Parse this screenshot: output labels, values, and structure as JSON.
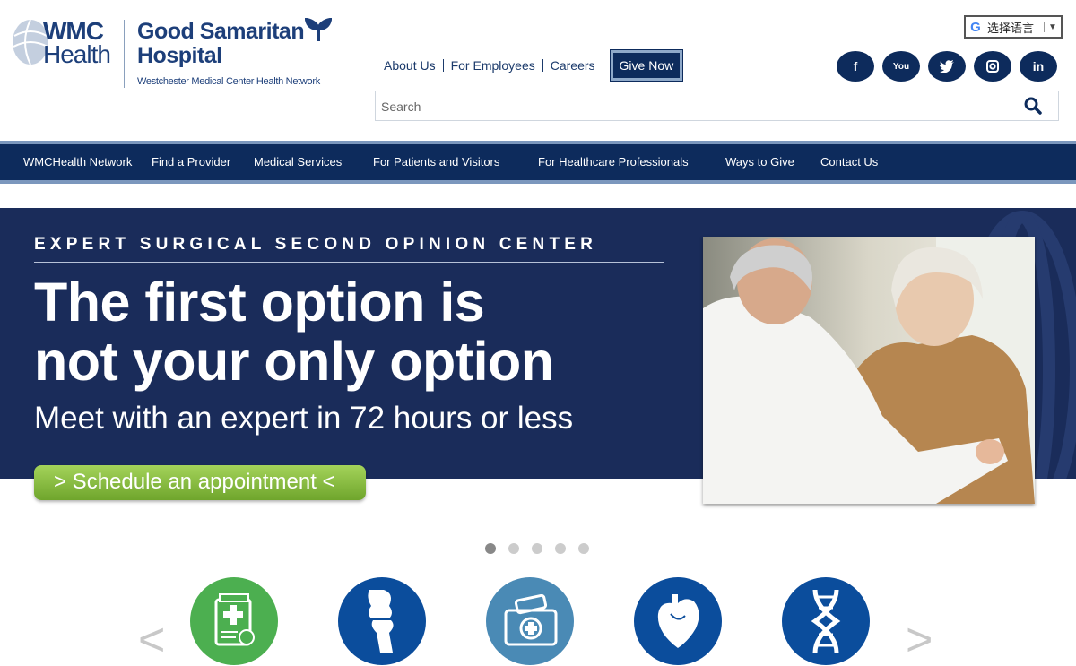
{
  "logo": {
    "wmc_line1": "WMC",
    "wmc_line2": "Health",
    "hospital_line1": "Good Samaritan",
    "hospital_line2": "Hospital",
    "network": "Westchester Medical Center Health Network"
  },
  "translate": {
    "label": "选择语言",
    "g_letter": "G",
    "arrow": "▼"
  },
  "top_links": [
    {
      "label": "About Us"
    },
    {
      "label": "For Employees"
    },
    {
      "label": "Careers"
    }
  ],
  "give_now": "Give Now",
  "social": [
    {
      "icon": "facebook-icon",
      "glyph": "f"
    },
    {
      "icon": "youtube-icon",
      "glyph": "You"
    },
    {
      "icon": "twitter-icon",
      "glyph": "t"
    },
    {
      "icon": "instagram-icon",
      "glyph": "◙"
    },
    {
      "icon": "linkedin-icon",
      "glyph": "in"
    }
  ],
  "search": {
    "placeholder": "Search"
  },
  "nav": [
    {
      "label": "WMCHealth Network"
    },
    {
      "label": "Find a Provider"
    },
    {
      "label": "Medical Services"
    },
    {
      "label": "For Patients and Visitors"
    },
    {
      "label": "For Healthcare Professionals"
    },
    {
      "label": "Ways to Give"
    },
    {
      "label": "Contact Us"
    }
  ],
  "hero": {
    "eyebrow": "EXPERT SURGICAL SECOND OPINION CENTER",
    "headline_1": "The first option is",
    "headline_2": "not your only option",
    "subline": "Meet with an expert in 72 hours or less",
    "cta": "> Schedule an appointment <"
  },
  "carousel": {
    "slide_count": 5,
    "active_slide": 1
  },
  "service_icons": [
    {
      "icon": "billing-icon",
      "color": "#4caf50"
    },
    {
      "icon": "orthopedics-icon",
      "color": "#0b4d9c"
    },
    {
      "icon": "first-aid-kit-icon",
      "color": "#4a8ab5"
    },
    {
      "icon": "heart-icon",
      "color": "#0b4d9c"
    },
    {
      "icon": "dna-icon",
      "color": "#0b4d9c"
    }
  ],
  "colors": {
    "navy": "#0d2b5c",
    "hero_bg": "#1a2c5a",
    "green": "#7dbb3a"
  },
  "arrows": {
    "prev": "<",
    "next": ">"
  }
}
